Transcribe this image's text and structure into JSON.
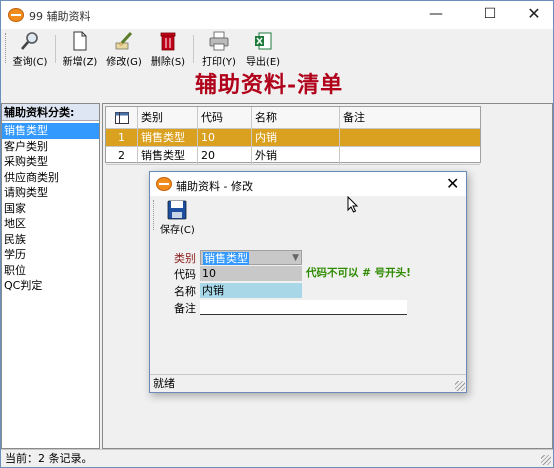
{
  "window": {
    "title": "99 辅助资料",
    "controls": [
      "—",
      "☐",
      "✕"
    ]
  },
  "toolbar": [
    {
      "label": "查询(C)",
      "icon": "search-icon"
    },
    {
      "label": "新增(Z)",
      "icon": "new-document-icon"
    },
    {
      "label": "修改(G)",
      "icon": "edit-icon"
    },
    {
      "label": "删除(S)",
      "icon": "trash-icon"
    },
    {
      "label": "打印(Y)",
      "icon": "printer-icon"
    },
    {
      "label": "导出(E)",
      "icon": "excel-export-icon"
    }
  ],
  "page_title": "辅助资料-清单",
  "category_panel": {
    "header": "辅助资料分类:",
    "items": [
      "销售类型",
      "客户类别",
      "采购类型",
      "供应商类别",
      "请购类型",
      "国家",
      "地区",
      "民族",
      "学历",
      "职位",
      "QC判定"
    ],
    "selected": "销售类型"
  },
  "grid": {
    "columns": [
      "类别",
      "代码",
      "名称",
      "备注"
    ],
    "rows": [
      {
        "n": "1",
        "cells": [
          "销售类型",
          "10",
          "内销",
          ""
        ]
      },
      {
        "n": "2",
        "cells": [
          "销售类型",
          "20",
          "外销",
          ""
        ]
      }
    ],
    "active_row_color": "#daa020"
  },
  "status": "当前：2 条记录。",
  "dialog": {
    "title": "辅助资料 - 修改",
    "save_label": "保存(C)",
    "fields": {
      "category_label": "类别",
      "category_value": "销售类型",
      "code_label": "代码",
      "code_value": "10",
      "name_label": "名称",
      "name_value": "内销",
      "note_label": "备注",
      "note_value": ""
    },
    "warning": "代码不可以 # 号开头!",
    "status": "就绪"
  },
  "colors": {
    "title_red": "#b0001a",
    "warning_green": "#2e8b00",
    "selection_blue": "#3399ff",
    "category_label_red": "#8b1a1a"
  }
}
